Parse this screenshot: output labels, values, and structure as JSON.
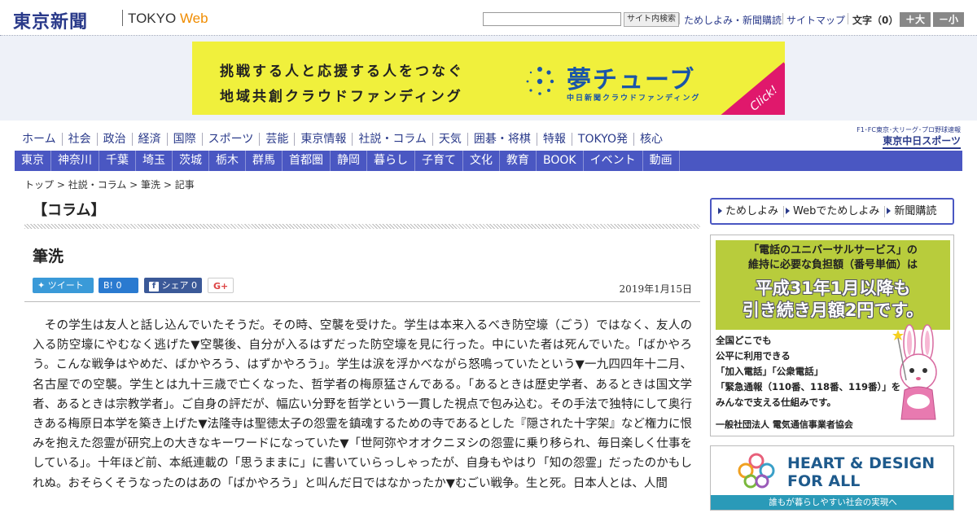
{
  "header": {
    "logo": "東京新聞",
    "logo_tokyo": "TOKYO",
    "logo_web": "Web",
    "search_button": "サイト内検索",
    "util_links": [
      "ためしよみ・新聞購読",
      "サイトマップ"
    ],
    "font_label": "文字（0）",
    "font_plus": "＋大",
    "font_minus": "－小"
  },
  "banner": {
    "line1": "挑戦する人と応援する人をつなぐ",
    "line2": "地域共創クラウドファンディング",
    "title": "夢チューブ",
    "subtitle": "中日新聞クラウドファンディング",
    "click": "Click!"
  },
  "nav_main": [
    "ホーム",
    "社会",
    "政治",
    "経済",
    "国際",
    "スポーツ",
    "芸能",
    "東京情報",
    "社説・コラム",
    "天気",
    "囲碁・将棋",
    "特報",
    "TOKYO発",
    "核心"
  ],
  "sports_logo": {
    "top": "F1･FC東京･大リーグ･プロ野球速報",
    "main": "東京中日スポーツ"
  },
  "nav_regional": [
    "東京",
    "神奈川",
    "千葉",
    "埼玉",
    "茨城",
    "栃木",
    "群馬",
    "首都圏",
    "静岡",
    "暮らし",
    "子育て",
    "文化",
    "教育",
    "BOOK",
    "イベント",
    "動画"
  ],
  "breadcrumb": {
    "top": "トップ",
    "section": "社説・コラム",
    "sub": "筆洗",
    "current": "記事",
    "sep": " > "
  },
  "article": {
    "section": "【コラム】",
    "title": "筆洗",
    "date": "2019年1月15日",
    "share": {
      "tweet": "ツイート",
      "hatena": "B! 0",
      "facebook": "シェア 0",
      "google": "G+"
    },
    "body": "その学生は友人と話し込んでいたそうだ。その時、空襲を受けた。学生は本来入るべき防空壕（ごう）ではなく、友人の入る防空壕にやむなく逃げた▼空襲後、自分が入るはずだった防空壕を見に行った。中にいた者は死んでいた。「ばかやろう。こんな戦争はやめだ、ばかやろう、はずかやろう」。学生は涙を浮かべながら怒鳴っていたという▼一九四四年十二月、名古屋での空襲。学生とは九十三歳で亡くなった、哲学者の梅原猛さんである。「あるときは歴史学者、あるときは国文学者、あるときは宗教学者」。ご自身の評だが、幅広い分野を哲学という一貫した視点で包み込む。その手法で独特にして奥行きある梅原日本学を築き上げた▼法隆寺は聖徳太子の怨霊を鎮魂するための寺であるとした『隠された十字架』など権力に恨みを抱えた怨霊が研究上の大きなキーワードになっていた▼「世阿弥やオオクニヌシの怨霊に乗り移られ、毎日楽しく仕事をしている」。十年ほど前、本紙連載の「思うままに」に書いていらっしゃったが、自身もやはり「知の怨霊」だったのかもしれぬ。おそらくそうなったのはあの「ばかやろう」と叫んだ日ではなかったか▼むごい戦争。生と死。日本人とは、人間"
  },
  "sidebar": {
    "nav": [
      "ためしよみ",
      "Webでためしよみ",
      "新聞購読"
    ],
    "ad1": {
      "q1": "「電話のユニバーサルサービス」の",
      "q2": "維持に必要な負担額（番号単価）は",
      "big1": "平成31年1月以降も",
      "big2": "引き続き月額2円です。",
      "l1": "全国どこでも",
      "l2": "公平に利用できる",
      "l3": "「加入電話」「公衆電話」",
      "l4": "「緊急通報（110番、118番、119番）」を",
      "l5": "みんなで支える仕組みです。",
      "org": "一般社団法人 電気通信事業者協会"
    },
    "ad2": {
      "t1": "HEART & DESIGN",
      "t2": "FOR ALL",
      "bar": "誰もが暮らしやすい社会の実現へ"
    }
  },
  "colors": {
    "brand": "#2a3a8a",
    "nav_bar": "#4a57c2",
    "banner": "#f0f03c",
    "web_orange": "#f08c00"
  }
}
